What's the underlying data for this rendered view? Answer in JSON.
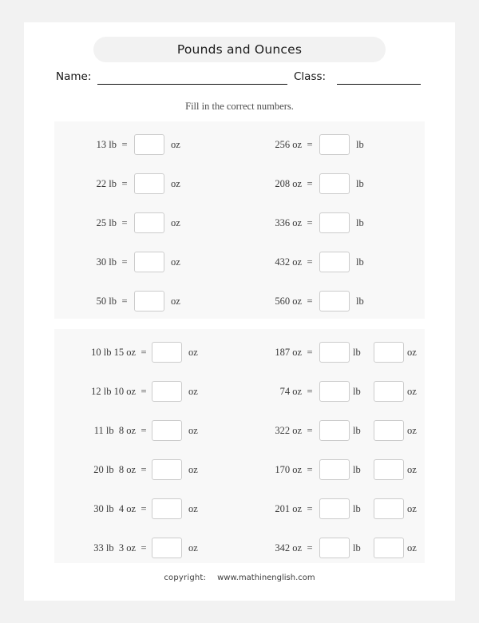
{
  "worksheet": {
    "title": "Pounds and Ounces",
    "name_label": "Name:",
    "class_label": "Class:",
    "instruction": "Fill in the correct numbers.",
    "footer": {
      "copyright_label": "copyright:",
      "url": "www.mathinenglish.com"
    },
    "colors": {
      "page_background": "#f2f2f2",
      "sheet": "#ffffff",
      "panel": "#f8f8f8",
      "title_pill": "#f2f2f2",
      "box_border": "#cccccc",
      "text": "#3a3a3a"
    },
    "sections": [
      {
        "id": "section-1",
        "answer_boxes_per_row": 1,
        "left_column": {
          "from_unit": "lb",
          "to_unit": "oz",
          "equals": "=",
          "rows": [
            {
              "term": "13 lb",
              "answer": "",
              "unit": "oz"
            },
            {
              "term": "22 lb",
              "answer": "",
              "unit": "oz"
            },
            {
              "term": "25 lb",
              "answer": "",
              "unit": "oz"
            },
            {
              "term": "30 lb",
              "answer": "",
              "unit": "oz"
            },
            {
              "term": "50 lb",
              "answer": "",
              "unit": "oz"
            }
          ]
        },
        "right_column": {
          "from_unit": "oz",
          "to_unit": "lb",
          "equals": "=",
          "rows": [
            {
              "term": "256 oz",
              "answer": "",
              "unit": "lb"
            },
            {
              "term": "208 oz",
              "answer": "",
              "unit": "lb"
            },
            {
              "term": "336 oz",
              "answer": "",
              "unit": "lb"
            },
            {
              "term": "432 oz",
              "answer": "",
              "unit": "lb"
            },
            {
              "term": "560 oz",
              "answer": "",
              "unit": "lb"
            }
          ]
        }
      },
      {
        "id": "section-2",
        "answer_boxes_per_row": 2,
        "left_column": {
          "from_unit": "lb oz",
          "to_unit": "oz",
          "equals": "=",
          "rows": [
            {
              "term": "10 lb 15 oz",
              "answer": "",
              "unit": "oz"
            },
            {
              "term": "12 lb 10 oz",
              "answer": "",
              "unit": "oz"
            },
            {
              "term": "11 lb  8 oz",
              "answer": "",
              "unit": "oz"
            },
            {
              "term": "20 lb  8 oz",
              "answer": "",
              "unit": "oz"
            },
            {
              "term": "30 lb  4 oz",
              "answer": "",
              "unit": "oz"
            },
            {
              "term": "33 lb  3 oz",
              "answer": "",
              "unit": "oz"
            }
          ]
        },
        "right_column": {
          "from_unit": "oz",
          "to_unit": "lb oz",
          "equals": "=",
          "rows": [
            {
              "term": "187 oz",
              "answer_lb": "",
              "unit_lb": "lb",
              "answer_oz": "",
              "unit_oz": "oz"
            },
            {
              "term": "74 oz",
              "answer_lb": "",
              "unit_lb": "lb",
              "answer_oz": "",
              "unit_oz": "oz"
            },
            {
              "term": "322 oz",
              "answer_lb": "",
              "unit_lb": "lb",
              "answer_oz": "",
              "unit_oz": "oz"
            },
            {
              "term": "170 oz",
              "answer_lb": "",
              "unit_lb": "lb",
              "answer_oz": "",
              "unit_oz": "oz"
            },
            {
              "term": "201 oz",
              "answer_lb": "",
              "unit_lb": "lb",
              "answer_oz": "",
              "unit_oz": "oz"
            },
            {
              "term": "342 oz",
              "answer_lb": "",
              "unit_lb": "lb",
              "answer_oz": "",
              "unit_oz": "oz"
            }
          ]
        }
      }
    ]
  }
}
